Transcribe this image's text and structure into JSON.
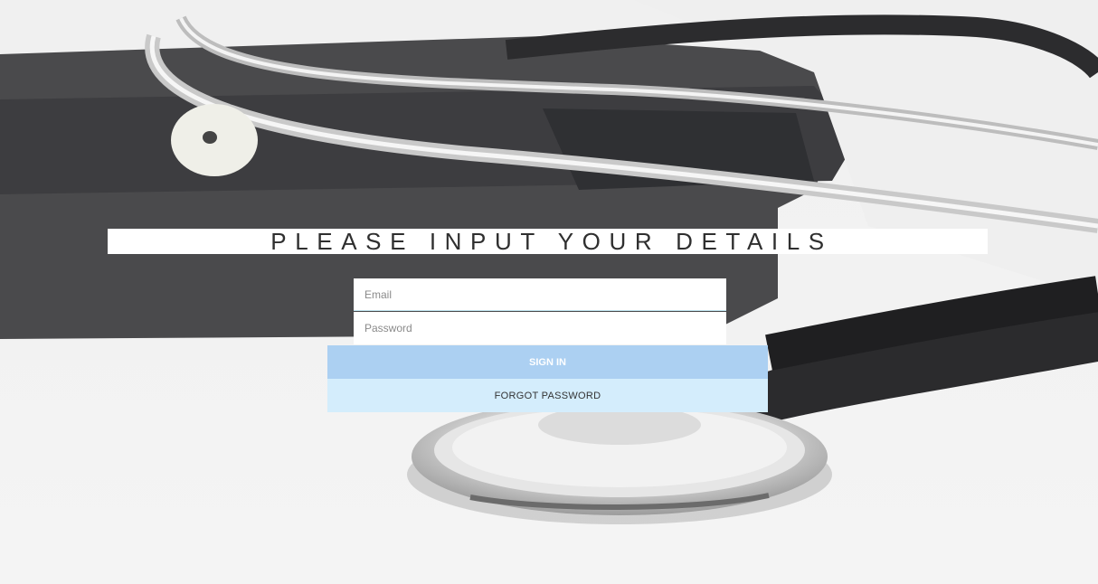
{
  "page": {
    "title": "PLEASE INPUT YOUR DETAILS"
  },
  "form": {
    "email_placeholder": "Email",
    "email_value": "",
    "password_placeholder": "Password",
    "password_value": "",
    "signin_label": "SIGN IN",
    "forgot_label": "FORGOT PASSWORD"
  },
  "colors": {
    "banner_bg": "#ffffff",
    "signin_bg": "#acd0f2",
    "forgot_bg": "#d4edfc",
    "field_divider": "#bfe4ef"
  },
  "background_image": {
    "subject": "stethoscope-photo"
  }
}
